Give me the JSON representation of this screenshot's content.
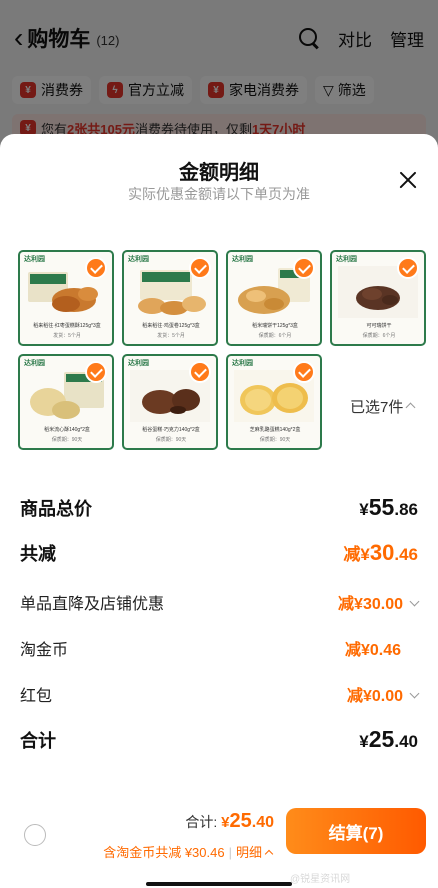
{
  "background_cart": {
    "back_icon": "chevron-left-icon",
    "title": "购物车",
    "count": "(12)",
    "compare_label": "对比",
    "manage_label": "管理",
    "chips": [
      {
        "icon": "coupon-icon",
        "label": "消费券"
      },
      {
        "icon": "lightning-icon",
        "label": "官方立减"
      },
      {
        "icon": "coupon-icon",
        "label": "家电消费券"
      },
      {
        "icon": "filter-icon",
        "label": "筛选"
      }
    ],
    "banner": {
      "prefix": "您有",
      "highlight1": "2张共105元",
      "middle": "消费券待使用，仅剩",
      "highlight2": "1天7小时"
    }
  },
  "modal": {
    "title": "金额明细",
    "subtitle": "实际优惠金额请以下单页为准",
    "close_icon": "close-icon",
    "products": [
      {
        "brand": "达利园",
        "caption": "稻来稻往·红枣蛋糕酥125g*3盒",
        "sub": "发货：5个月",
        "checked": true
      },
      {
        "brand": "达利园",
        "caption": "稻来稻往·鸡蛋卷125g*3盒",
        "sub": "发货：5个月",
        "checked": true
      },
      {
        "brand": "达利园",
        "caption": "稻米瑞饼干125g*3盒",
        "sub": "保质期：6个月",
        "checked": true
      },
      {
        "brand": "达利园",
        "caption": "可可瑞饼干",
        "sub": "保质期：6个月",
        "checked": true
      },
      {
        "brand": "达利园",
        "caption": "稻米流心酥140g*2盒",
        "sub": "保质期：90天",
        "checked": true
      },
      {
        "brand": "达利园",
        "caption": "稻谷蛋糕·巧克力140g*2盒",
        "sub": "保质期：90天",
        "checked": true
      },
      {
        "brand": "达利园",
        "caption": "芝麻乳酪蛋糕140g*2盒",
        "sub": "保质期：90天",
        "checked": true
      }
    ],
    "selected_label": "已选7件",
    "summary": {
      "goods_total": {
        "label": "商品总价",
        "currency": "¥",
        "int": "55",
        "dec": ".86"
      },
      "discount_total": {
        "label": "共减",
        "prefix": "减¥",
        "int": "30",
        "dec": ".46"
      },
      "store_discount": {
        "label": "单品直降及店铺优惠",
        "value": "减¥30.00"
      },
      "taojinbi": {
        "label": "淘金币",
        "value": "减¥0.46"
      },
      "hongbao": {
        "label": "红包",
        "value": "减¥0.00"
      },
      "grand_total": {
        "label": "合计",
        "currency": "¥",
        "int": "25",
        "dec": ".40"
      }
    }
  },
  "bottom_bar": {
    "total_label": "合计: ",
    "total_currency": "¥",
    "total_int": "25",
    "total_dec": ".40",
    "discount_note": "含淘金币共减 ¥30.46",
    "detail_label": "明细",
    "checkout_label": "结算(7)"
  },
  "watermark": "@锐星资讯网",
  "colors": {
    "accent": "#ff6a00",
    "checkout_gradient_start": "#ff8c1a",
    "checkout_gradient_end": "#ff5a00",
    "product_frame": "#2d7a4b",
    "coupon_red": "#e8352b"
  }
}
